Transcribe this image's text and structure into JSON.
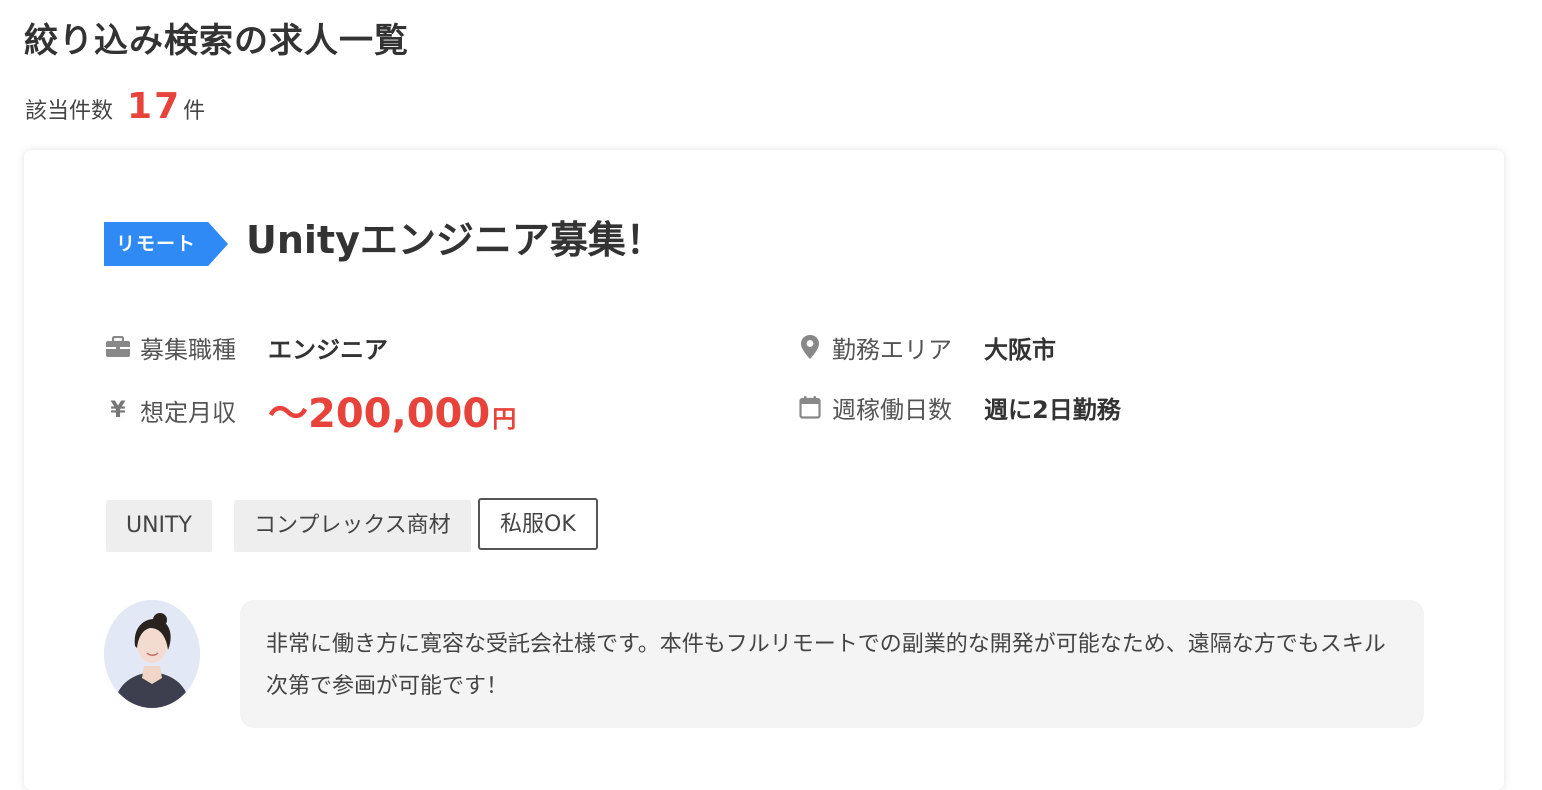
{
  "page": {
    "title": "絞り込み検索の求人一覧",
    "count_label": "該当件数",
    "count_value": "17",
    "count_unit": "件"
  },
  "job": {
    "badge": "リモート",
    "title": "Unityエンジニア募集！",
    "fields": {
      "occupation_label": "募集職種",
      "occupation_value": "エンジニア",
      "salary_label": "想定月収",
      "salary_value": "〜200,000",
      "salary_unit": "円",
      "area_label": "勤務エリア",
      "area_value": "大阪市",
      "workdays_label": "週稼働日数",
      "workdays_value": "週に2日勤務"
    },
    "tags": [
      {
        "label": "UNITY"
      },
      {
        "label": "コンプレックス商材"
      },
      {
        "label": "私服OK"
      }
    ],
    "comment": "非常に働き方に寛容な受託会社様です。本件もフルリモートでの副業的な開発が可能なため、遠隔な方でもスキル次第で参画が可能です！"
  },
  "icons": {
    "occupation": "briefcase-icon",
    "salary": "yen-icon",
    "area": "map-pin-icon",
    "workdays": "calendar-icon"
  },
  "colors": {
    "accent_red": "#e8433b",
    "badge_blue": "#2f8af5",
    "tag_bg": "#eeeeee",
    "comment_bg": "#f4f4f4"
  },
  "yen_symbol": "¥"
}
